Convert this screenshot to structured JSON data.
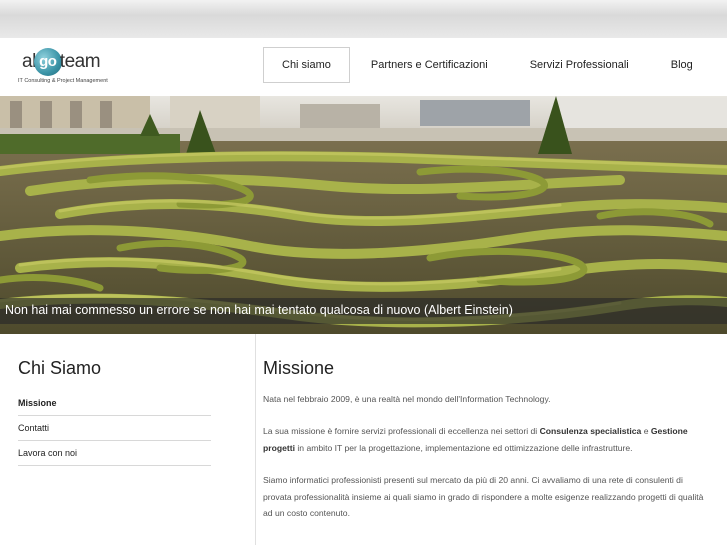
{
  "logo": {
    "word_left": "al",
    "word_circle": "go",
    "word_right": "team",
    "tagline": "IT Consulting & Project Management"
  },
  "nav": {
    "items": [
      {
        "label": "Chi siamo",
        "active": true
      },
      {
        "label": "Partners e Certificazioni",
        "active": false
      },
      {
        "label": "Servizi Professionali",
        "active": false
      },
      {
        "label": "Blog",
        "active": false
      }
    ]
  },
  "hero": {
    "caption": "Non hai mai commesso un errore se non hai mai tentato qualcosa di nuovo (Albert Einstein)"
  },
  "sidebar": {
    "title": "Chi Siamo",
    "items": [
      {
        "label": "Missione",
        "active": true
      },
      {
        "label": "Contatti",
        "active": false
      },
      {
        "label": "Lavora con noi",
        "active": false
      }
    ]
  },
  "main": {
    "title": "Missione",
    "p1": "Nata nel febbraio 2009, è una realtà nel mondo dell'Information Technology.",
    "p2_a": "La sua missione è fornire servizi professionali di eccellenza nei settori di ",
    "p2_b": "Consulenza specialistica",
    "p2_c": " e ",
    "p2_d": "Gestione progetti",
    "p2_e": " in ambito IT per la progettazione, implementazione ed ottimizzazione delle infrastrutture.",
    "p3": "Siamo informatici professionisti presenti sul mercato da più di 20 anni. Ci avvaliamo di una rete di consulenti di provata professionalità insieme ai quali siamo in grado di rispondere a molte esigenze realizzando progetti di qualità ad un costo contenuto."
  }
}
